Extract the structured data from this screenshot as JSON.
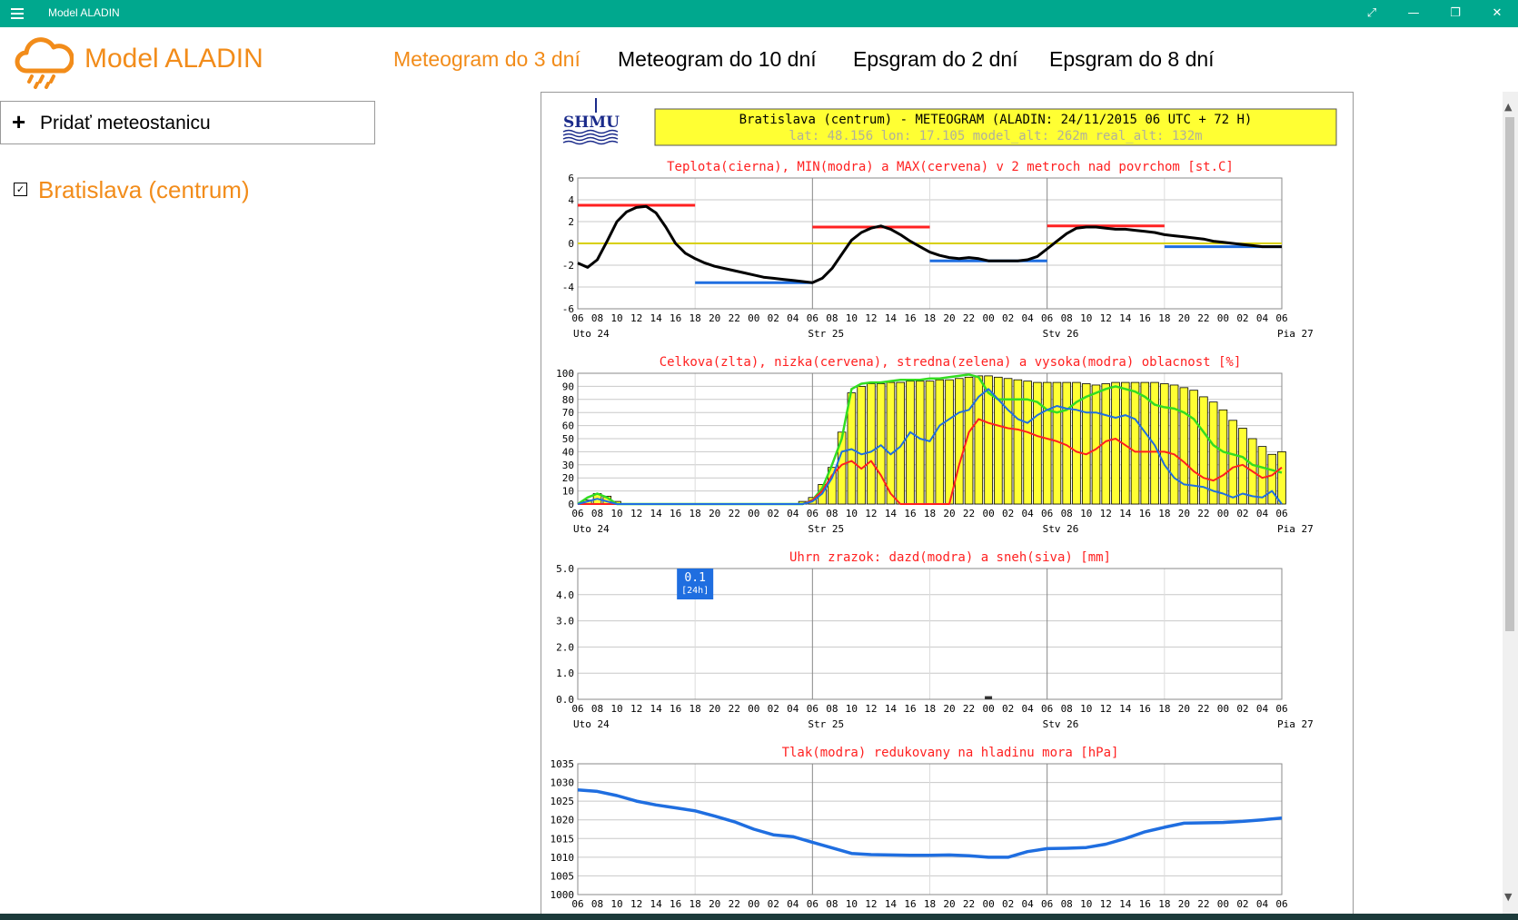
{
  "window": {
    "title": "Model ALADIN",
    "menu_icon": "hamburger-icon",
    "controls": [
      "fullscreen-icon",
      "minimize-icon",
      "restore-icon",
      "close-icon"
    ],
    "accent": "#00a88e"
  },
  "app": {
    "title": "Model ALADIN",
    "logo_icon": "cloud-rain-icon",
    "brand_color": "#f28c1a"
  },
  "tabs": [
    {
      "label": "Meteogram do 3 dní",
      "active": true
    },
    {
      "label": "Meteogram do 10 dní",
      "active": false
    },
    {
      "label": "Epsgram do 2 dní",
      "active": false
    },
    {
      "label": "Epsgram do 8 dní",
      "active": false
    }
  ],
  "sidebar": {
    "add_label": "Pridať meteostanicu",
    "add_icon": "plus-icon",
    "stations": [
      {
        "label": "Bratislava (centrum)",
        "checked": true
      }
    ]
  },
  "meteogram": {
    "logo_text": "SHMU",
    "header_line1": "Bratislava (centrum) - METEOGRAM (ALADIN: 24/11/2015 06 UTC + 72 H)",
    "header_line2": "lat: 48.156  lon: 17.105  model_alt: 262m  real_alt: 132m",
    "hours": [
      "06",
      "08",
      "10",
      "12",
      "14",
      "16",
      "18",
      "20",
      "22",
      "00",
      "02",
      "04",
      "06",
      "08",
      "10",
      "12",
      "14",
      "16",
      "18",
      "20",
      "22",
      "00",
      "02",
      "04",
      "06",
      "08",
      "10",
      "12",
      "14",
      "16",
      "18",
      "20",
      "22",
      "00",
      "02",
      "04",
      "06"
    ],
    "days": [
      "Uto 24",
      "Str 25",
      "Stv 26",
      "Pia 27"
    ],
    "charts": [
      {
        "title": "Teplota(cierna), MIN(modra) a MAX(cervena) v 2 metroch nad povrchom [st.C]",
        "ticks": [
          "6",
          "4",
          "2",
          "0",
          "-2",
          "-4",
          "-6"
        ],
        "chart_data": {
          "type": "line",
          "ylim": [
            -6,
            6
          ],
          "x_hours": [
            0,
            1,
            2,
            3,
            4,
            5,
            6,
            7,
            8,
            9,
            10,
            11,
            12,
            13,
            14,
            15,
            16,
            17,
            18,
            19,
            20,
            21,
            22,
            23,
            24,
            25,
            26,
            27,
            28,
            29,
            30,
            31,
            32,
            33,
            34,
            35,
            36,
            37,
            38,
            39,
            40,
            41,
            42,
            43,
            44,
            45,
            46,
            47,
            48,
            49,
            50,
            51,
            52,
            53,
            54,
            55,
            56,
            57,
            58,
            59,
            60,
            61,
            62,
            63,
            64,
            65,
            66,
            67,
            68,
            69,
            70,
            71,
            72
          ],
          "temperature": [
            -1.8,
            -2.2,
            -1.5,
            0.2,
            2.0,
            2.9,
            3.3,
            3.4,
            2.8,
            1.5,
            0.0,
            -0.9,
            -1.4,
            -1.8,
            -2.1,
            -2.3,
            -2.5,
            -2.7,
            -2.9,
            -3.1,
            -3.2,
            -3.3,
            -3.4,
            -3.5,
            -3.6,
            -3.2,
            -2.3,
            -1.0,
            0.3,
            1.0,
            1.4,
            1.6,
            1.3,
            0.8,
            0.2,
            -0.3,
            -0.8,
            -1.1,
            -1.3,
            -1.4,
            -1.3,
            -1.4,
            -1.6,
            -1.6,
            -1.6,
            -1.6,
            -1.5,
            -1.2,
            -0.5,
            0.2,
            0.9,
            1.4,
            1.5,
            1.5,
            1.4,
            1.3,
            1.3,
            1.2,
            1.1,
            1.0,
            0.8,
            0.7,
            0.6,
            0.5,
            0.4,
            0.2,
            0.1,
            0.0,
            -0.1,
            -0.2,
            -0.3,
            -0.3,
            -0.3
          ],
          "max_bars": [
            {
              "from": 0,
              "to": 12,
              "value": 3.5
            },
            {
              "from": 24,
              "to": 36,
              "value": 1.5
            },
            {
              "from": 48,
              "to": 60,
              "value": 1.6
            }
          ],
          "min_bars": [
            {
              "from": 12,
              "to": 24,
              "value": -3.6
            },
            {
              "from": 36,
              "to": 48,
              "value": -1.6
            },
            {
              "from": 60,
              "to": 72,
              "value": -0.3
            }
          ],
          "colors": {
            "temperature": "#000000",
            "max": "#ff2020",
            "min": "#1f6ee0",
            "zero": "#d8d000"
          }
        }
      },
      {
        "title": "Celkova(zlta), nizka(cervena), stredna(zelena) a vysoka(modra) oblacnost [%]",
        "ticks": [
          "100",
          "90",
          "80",
          "70",
          "60",
          "50",
          "40",
          "30",
          "20",
          "10",
          "0"
        ],
        "chart_data": {
          "type": "bar",
          "ylim": [
            0,
            100
          ],
          "x_hours": [
            0,
            1,
            2,
            3,
            4,
            5,
            6,
            7,
            8,
            9,
            10,
            11,
            12,
            13,
            14,
            15,
            16,
            17,
            18,
            19,
            20,
            21,
            22,
            23,
            24,
            25,
            26,
            27,
            28,
            29,
            30,
            31,
            32,
            33,
            34,
            35,
            36,
            37,
            38,
            39,
            40,
            41,
            42,
            43,
            44,
            45,
            46,
            47,
            48,
            49,
            50,
            51,
            52,
            53,
            54,
            55,
            56,
            57,
            58,
            59,
            60,
            61,
            62,
            63,
            64,
            65,
            66,
            67,
            68,
            69,
            70,
            71,
            72
          ],
          "total": [
            0,
            3,
            8,
            6,
            2,
            0,
            0,
            0,
            0,
            0,
            0,
            0,
            0,
            0,
            0,
            0,
            0,
            0,
            0,
            0,
            0,
            0,
            0,
            2,
            5,
            15,
            28,
            55,
            85,
            90,
            92,
            92,
            93,
            93,
            94,
            94,
            94,
            95,
            95,
            96,
            97,
            98,
            98,
            97,
            96,
            95,
            94,
            93,
            93,
            93,
            93,
            93,
            92,
            91,
            92,
            93,
            93,
            93,
            93,
            93,
            92,
            91,
            89,
            87,
            82,
            78,
            72,
            64,
            58,
            50,
            44,
            38,
            40
          ],
          "low": [
            0,
            0,
            0,
            0,
            0,
            0,
            0,
            0,
            0,
            0,
            0,
            0,
            0,
            0,
            0,
            0,
            0,
            0,
            0,
            0,
            0,
            0,
            0,
            0,
            3,
            10,
            22,
            30,
            33,
            27,
            33,
            22,
            8,
            0,
            0,
            0,
            0,
            0,
            0,
            30,
            55,
            65,
            62,
            60,
            58,
            57,
            55,
            52,
            50,
            48,
            45,
            40,
            38,
            42,
            48,
            50,
            45,
            40,
            40,
            40,
            40,
            38,
            32,
            25,
            20,
            18,
            22,
            28,
            30,
            25,
            20,
            22,
            28
          ],
          "mid": [
            0,
            5,
            8,
            5,
            0,
            0,
            0,
            0,
            0,
            0,
            0,
            0,
            0,
            0,
            0,
            0,
            0,
            0,
            0,
            0,
            0,
            0,
            0,
            0,
            3,
            12,
            30,
            50,
            88,
            92,
            93,
            93,
            94,
            95,
            95,
            95,
            96,
            96,
            97,
            98,
            99,
            97,
            85,
            80,
            80,
            80,
            80,
            78,
            72,
            70,
            72,
            78,
            82,
            85,
            88,
            90,
            88,
            86,
            82,
            76,
            74,
            73,
            70,
            65,
            55,
            45,
            40,
            38,
            36,
            30,
            28,
            26,
            24
          ],
          "high": [
            0,
            2,
            4,
            2,
            0,
            0,
            0,
            0,
            0,
            0,
            0,
            0,
            0,
            0,
            0,
            0,
            0,
            0,
            0,
            0,
            0,
            0,
            0,
            0,
            2,
            8,
            20,
            40,
            42,
            38,
            40,
            45,
            38,
            44,
            55,
            50,
            48,
            60,
            65,
            70,
            72,
            82,
            88,
            80,
            72,
            65,
            62,
            68,
            72,
            75,
            73,
            72,
            70,
            70,
            68,
            66,
            68,
            65,
            55,
            45,
            30,
            20,
            15,
            14,
            13,
            10,
            8,
            5,
            8,
            6,
            5,
            10,
            0
          ],
          "colors": {
            "total": "#ffff33",
            "low": "#ff2020",
            "mid": "#33dd22",
            "high": "#1f6ee0"
          }
        }
      },
      {
        "title": "Uhrn zrazok: dazd(modra) a sneh(siva) [mm]",
        "ticks": [
          "5.0",
          "4.0",
          "3.0",
          "2.0",
          "1.0",
          "0.0"
        ],
        "badge_value": "0.1",
        "badge_period": "[24h]",
        "chart_data": {
          "type": "bar",
          "ylim": [
            0,
            5
          ],
          "rain": [
            {
              "hour": 42,
              "value": 0.05
            }
          ],
          "total_24h": 0.1,
          "colors": {
            "rain": "#1f6ee0",
            "snow": "#999999"
          }
        }
      },
      {
        "title": "Tlak(modra) redukovany na hladinu mora [hPa]",
        "ticks": [
          "1035",
          "1030",
          "1025",
          "1020",
          "1015",
          "1010",
          "1005",
          "1000"
        ],
        "chart_data": {
          "type": "line",
          "ylim": [
            1000,
            1035
          ],
          "x_hours": [
            0,
            2,
            4,
            6,
            8,
            10,
            12,
            14,
            16,
            18,
            20,
            22,
            24,
            26,
            28,
            30,
            32,
            34,
            36,
            38,
            40,
            42,
            44,
            46,
            48,
            50,
            52,
            54,
            56,
            58,
            60,
            62,
            64,
            66,
            68,
            70,
            72
          ],
          "pressure": [
            1028,
            1027.6,
            1026.5,
            1025,
            1024,
            1023.2,
            1022.4,
            1021,
            1019.5,
            1017.5,
            1016,
            1015.5,
            1014,
            1012.5,
            1011,
            1010.7,
            1010.6,
            1010.5,
            1010.5,
            1010.6,
            1010.4,
            1010.0,
            1010.0,
            1011.5,
            1012.3,
            1012.4,
            1012.6,
            1013.5,
            1015,
            1016.8,
            1018,
            1019.1,
            1019.2,
            1019.3,
            1019.6,
            1020,
            1020.5
          ],
          "colors": {
            "pressure": "#1f6ee0"
          }
        }
      }
    ]
  }
}
